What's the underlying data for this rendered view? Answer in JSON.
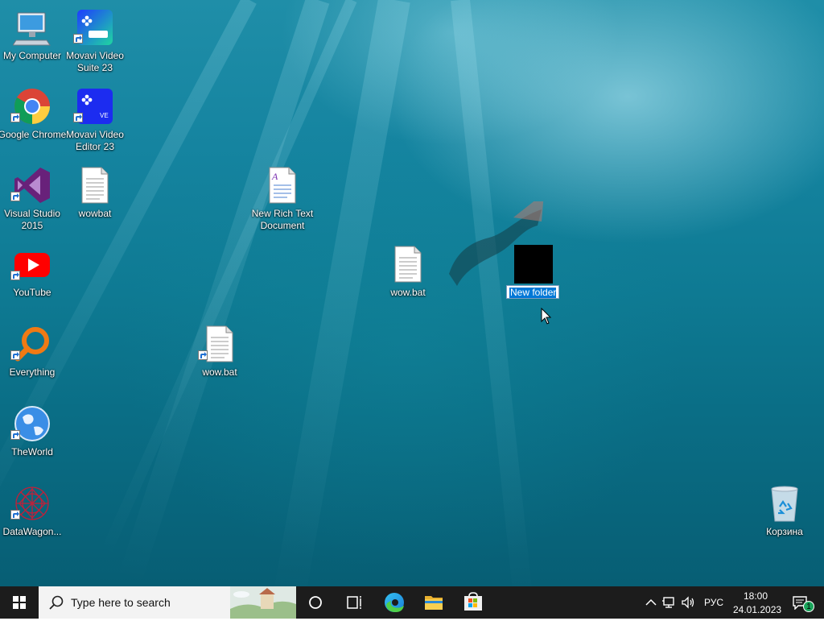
{
  "desktop": {
    "icons": [
      {
        "id": "my-computer",
        "label": "My Computer"
      },
      {
        "id": "movavi-suite",
        "label": "Movavi Video Suite 23"
      },
      {
        "id": "google-chrome",
        "label": "Google Chrome"
      },
      {
        "id": "movavi-editor",
        "label": "Movavi Video Editor 23"
      },
      {
        "id": "visual-studio",
        "label": "Visual Studio 2015"
      },
      {
        "id": "wowbat",
        "label": "wowbat"
      },
      {
        "id": "new-rtf",
        "label": "New Rich Text Document"
      },
      {
        "id": "youtube",
        "label": "YouTube"
      },
      {
        "id": "wow-bat-1",
        "label": "wow.bat"
      },
      {
        "id": "everything",
        "label": "Everything"
      },
      {
        "id": "wow-bat-2",
        "label": "wow.bat"
      },
      {
        "id": "theworld",
        "label": "TheWorld"
      },
      {
        "id": "datawagon",
        "label": "DataWagon..."
      },
      {
        "id": "recycle-bin",
        "label": "Корзина"
      }
    ],
    "rename_field": {
      "value": "New folder"
    }
  },
  "taskbar": {
    "search_placeholder": "Type here to search",
    "language": "РУС",
    "time": "18:00",
    "date": "24.01.2023",
    "notification_count": "1"
  },
  "colors": {
    "taskbar": "#1c1c1c",
    "selection": "#0078d7",
    "search_bg": "#f3f3f3"
  }
}
